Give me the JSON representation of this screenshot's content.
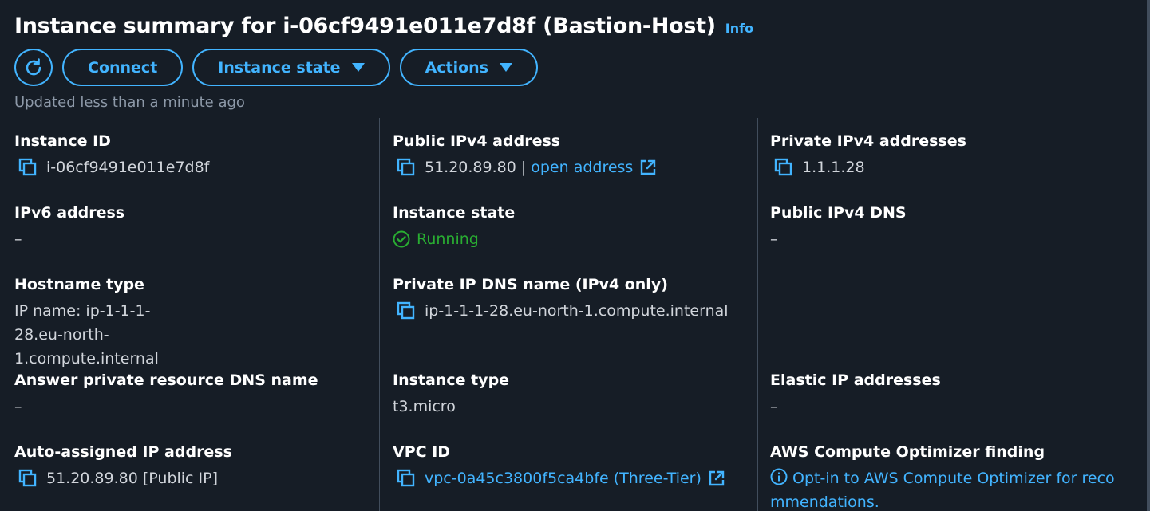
{
  "header": {
    "title": "Instance summary for i-06cf9491e011e7d8f (Bastion-Host)",
    "info_label": "Info"
  },
  "toolbar": {
    "refresh_icon": "refresh-icon",
    "connect_label": "Connect",
    "instance_state_label": "Instance state",
    "actions_label": "Actions"
  },
  "updated_text": "Updated less than a minute ago",
  "columns": {
    "left": {
      "instance_id": {
        "label": "Instance ID",
        "value": "i-06cf9491e011e7d8f"
      },
      "ipv6": {
        "label": "IPv6 address",
        "value": "–"
      },
      "hostname_type": {
        "label": "Hostname type",
        "value": "IP name: ip-1-1-1-28.eu-north-1.compute.internal",
        "line1": "IP name: ip-1-1-1-28.eu-north-",
        "line2": "1.compute.internal"
      },
      "answer_dns": {
        "label": "Answer private resource DNS name",
        "value": "–"
      },
      "auto_ip": {
        "label": "Auto-assigned IP address",
        "value": "51.20.89.80 [Public IP]"
      }
    },
    "middle": {
      "public_ipv4": {
        "label": "Public IPv4 address",
        "value": "51.20.89.80",
        "separator": "|",
        "link_label": "open address"
      },
      "instance_state": {
        "label": "Instance state",
        "value": "Running"
      },
      "private_dns": {
        "label": "Private IP DNS name (IPv4 only)",
        "value": "ip-1-1-1-28.eu-north-1.compute.internal"
      },
      "instance_type": {
        "label": "Instance type",
        "value": "t3.micro"
      },
      "vpc_id": {
        "label": "VPC ID",
        "value": "vpc-0a45c3800f5ca4bfe (Three-Tier)"
      }
    },
    "right": {
      "private_ipv4": {
        "label": "Private IPv4 addresses",
        "value": "1.1.1.28"
      },
      "public_dns": {
        "label": "Public IPv4 DNS",
        "value": "–"
      },
      "elastic_ip": {
        "label": "Elastic IP addresses",
        "value": "–"
      },
      "optimizer": {
        "label": "AWS Compute Optimizer finding",
        "line1": "Opt-in to AWS Compute Optimizer for reco",
        "line2": "mmendations."
      }
    }
  },
  "colors": {
    "background": "#161d26",
    "accent": "#42b4ff",
    "running": "#29ad32",
    "muted": "#8d99a8"
  }
}
